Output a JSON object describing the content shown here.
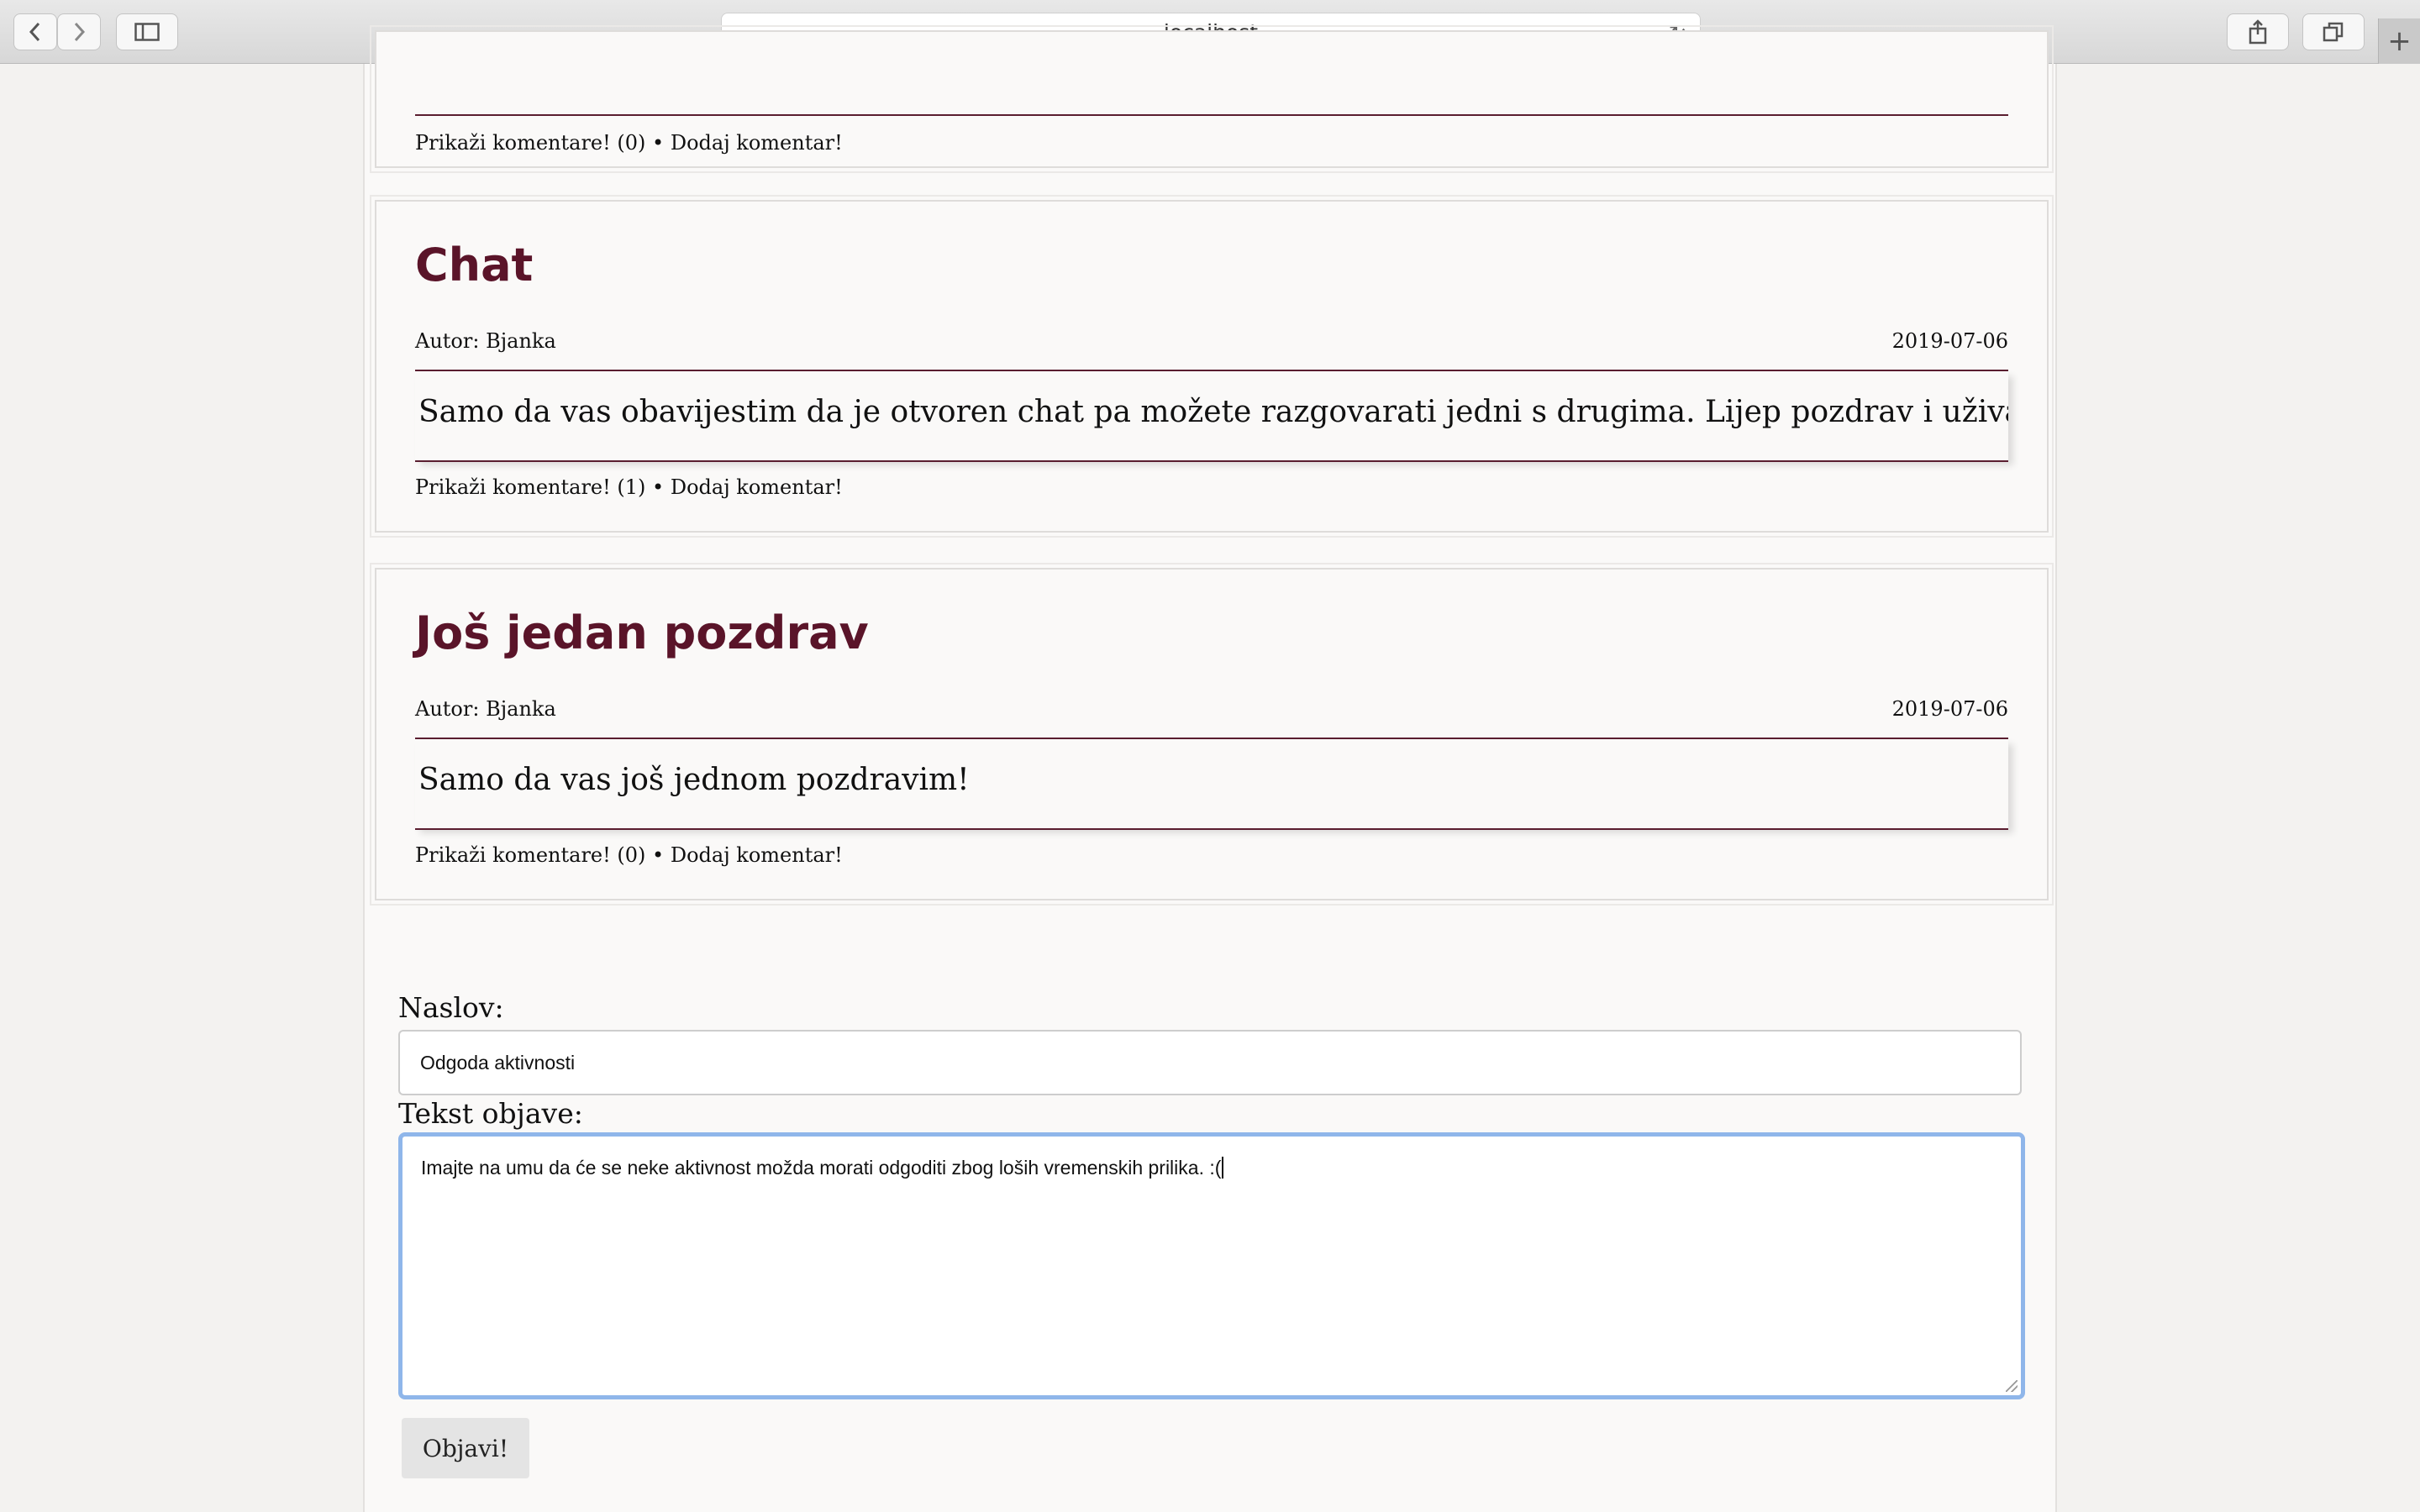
{
  "browser": {
    "url": "localhost",
    "back_icon": "chevron-left-icon",
    "forward_icon": "chevron-right-icon",
    "sidebar_icon": "sidebar-icon",
    "reload_icon": "reload-icon",
    "share_icon": "share-icon",
    "tabs_icon": "tabs-icon",
    "new_tab_icon": "plus-icon"
  },
  "colors": {
    "title": "#5a1429",
    "accent_rule": "#5a1e30",
    "focus": "#8fb6ea"
  },
  "posts": [
    {
      "show_comments": "Prikaži komentare! (0)",
      "separator": "•",
      "add_comment": "Dodaj komentar!"
    },
    {
      "title": "Chat",
      "author": "Autor: Bjanka",
      "date": "2019-07-06",
      "text": "Samo da vas obavijestim da je otvoren chat pa možete razgovarati jedni s drugima. Lijep pozdrav i uživajte u ljetu!",
      "show_comments": "Prikaži komentare! (1)",
      "separator": "•",
      "add_comment": "Dodaj komentar!"
    },
    {
      "title": "Još jedan pozdrav",
      "author": "Autor: Bjanka",
      "date": "2019-07-06",
      "text": "Samo da vas još jednom pozdravim!",
      "show_comments": "Prikaži komentare! (0)",
      "separator": "•",
      "add_comment": "Dodaj komentar!"
    }
  ],
  "form": {
    "title_label": "Naslov:",
    "title_value": "Odgoda aktivnosti",
    "text_label": "Tekst objave:",
    "text_value": "Imajte na umu da će se neke aktivnost možda morati odgoditi zbog loših vremenskih prilika. :(",
    "submit_label": "Objavi!"
  }
}
